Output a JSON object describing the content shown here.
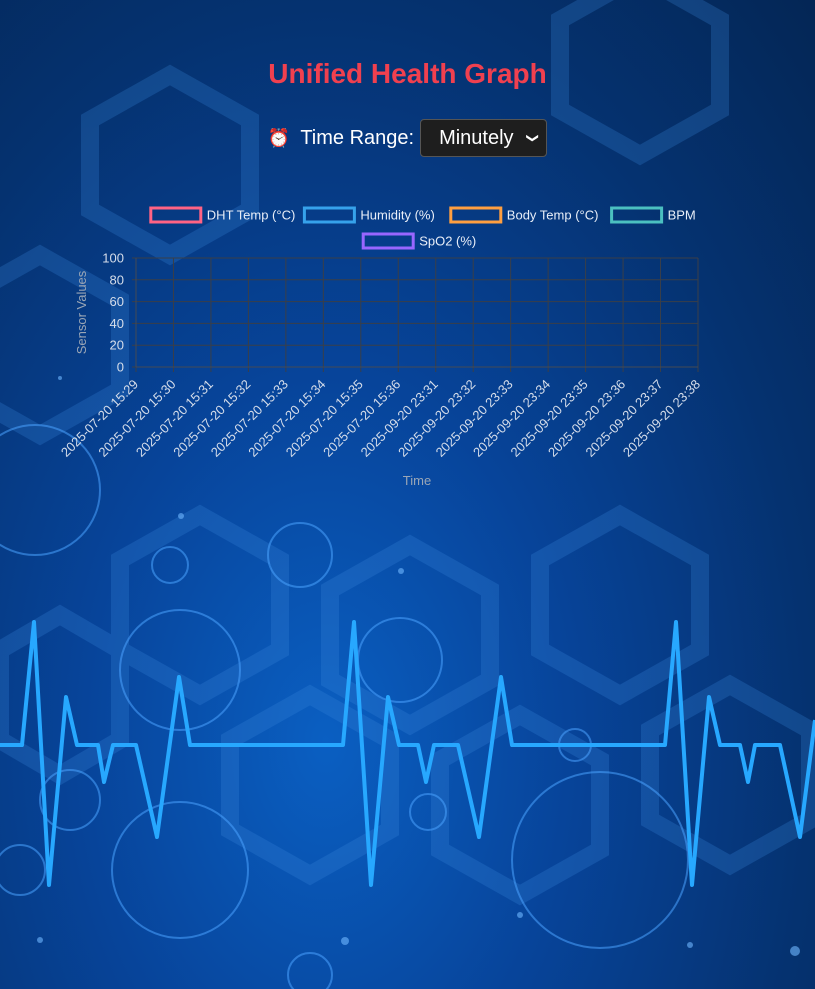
{
  "page": {
    "title": "Unified Health Graph"
  },
  "controls": {
    "alarm_icon": "alarm-clock-icon",
    "time_range_label": "Time Range:",
    "time_range_value": "Minutely"
  },
  "chart_data": {
    "type": "line",
    "ylabel": "Sensor Values",
    "xlabel": "Time",
    "ylim": [
      0,
      100
    ],
    "y_ticks": [
      "0",
      "20",
      "40",
      "60",
      "80",
      "100"
    ],
    "grid": true,
    "legend_position": "top",
    "categories": [
      "2025-07-20 15:29",
      "2025-07-20 15:30",
      "2025-07-20 15:31",
      "2025-07-20 15:32",
      "2025-07-20 15:33",
      "2025-07-20 15:34",
      "2025-07-20 15:35",
      "2025-07-20 15:36",
      "2025-09-20 23:31",
      "2025-09-20 23:32",
      "2025-09-20 23:33",
      "2025-09-20 23:34",
      "2025-09-20 23:35",
      "2025-09-20 23:36",
      "2025-09-20 23:37",
      "2025-09-20 23:38"
    ],
    "series": [
      {
        "name": "DHT Temp (°C)",
        "color": "#ff6384",
        "values": []
      },
      {
        "name": "Humidity (%)",
        "color": "#36a2eb",
        "values": []
      },
      {
        "name": "Body Temp (°C)",
        "color": "#ff9f40",
        "values": []
      },
      {
        "name": "BPM",
        "color": "#4bc0c0",
        "values": []
      },
      {
        "name": "SpO2 (%)",
        "color": "#9966ff",
        "values": []
      }
    ]
  }
}
